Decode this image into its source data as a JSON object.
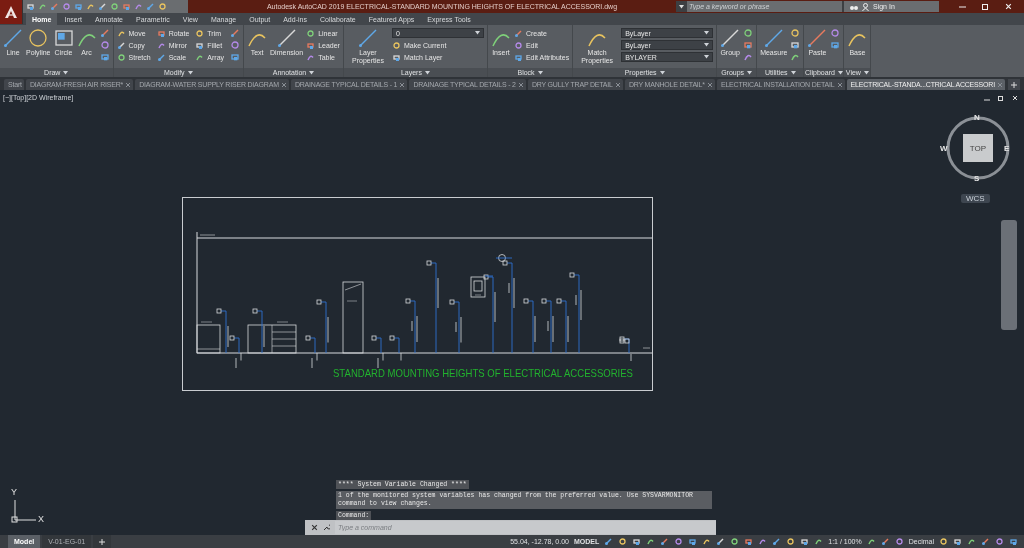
{
  "title_bar": {
    "title": "Autodesk AutoCAD 2019    ELECTRICAL-STANDARD MOUNTING HEIGHTS OF ELECTRICAL ACCESSORI.dwg",
    "search": {
      "placeholder": "Type a keyword or phrase"
    },
    "sign_in": "Sign In"
  },
  "ribbon_tabs": [
    {
      "label": "Home",
      "selected": true
    },
    {
      "label": "Insert",
      "selected": false
    },
    {
      "label": "Annotate",
      "selected": false
    },
    {
      "label": "Parametric",
      "selected": false
    },
    {
      "label": "View",
      "selected": false
    },
    {
      "label": "Manage",
      "selected": false
    },
    {
      "label": "Output",
      "selected": false
    },
    {
      "label": "Add-ins",
      "selected": false
    },
    {
      "label": "Collaborate",
      "selected": false
    },
    {
      "label": "Featured Apps",
      "selected": false
    },
    {
      "label": "Express Tools",
      "selected": false
    }
  ],
  "ribbon_panels": [
    {
      "title": "Draw",
      "tools": [
        {
          "kind": "large",
          "label": "Line"
        },
        {
          "kind": "large",
          "label": "Polyline"
        },
        {
          "kind": "large",
          "label": "Circle"
        },
        {
          "kind": "large",
          "label": "Arc"
        },
        {
          "kind": "icon"
        },
        {
          "kind": "icon"
        },
        {
          "kind": "icon"
        }
      ]
    },
    {
      "title": "Modify",
      "tools": [
        {
          "kind": "small",
          "label": "Move"
        },
        {
          "kind": "small",
          "label": "Copy"
        },
        {
          "kind": "small",
          "label": "Stretch"
        },
        {
          "kind": "small",
          "label": "Rotate"
        },
        {
          "kind": "small",
          "label": "Mirror"
        },
        {
          "kind": "small",
          "label": "Scale"
        },
        {
          "kind": "small",
          "label": "Trim"
        },
        {
          "kind": "small",
          "label": "Fillet"
        },
        {
          "kind": "small",
          "label": "Array"
        },
        {
          "kind": "icon"
        },
        {
          "kind": "icon"
        },
        {
          "kind": "icon"
        }
      ]
    },
    {
      "title": "Annotation",
      "tools": [
        {
          "kind": "large",
          "label": "Text"
        },
        {
          "kind": "large",
          "label": "Dimension"
        },
        {
          "kind": "small",
          "label": "Linear"
        },
        {
          "kind": "small",
          "label": "Leader"
        },
        {
          "kind": "small",
          "label": "Table"
        }
      ]
    },
    {
      "title": "Layers",
      "tools": [
        {
          "kind": "large",
          "label": "Layer Properties"
        },
        {
          "kind": "dropdown",
          "label": "0"
        },
        {
          "kind": "small",
          "label": "Make Current"
        },
        {
          "kind": "small",
          "label": "Match Layer"
        }
      ]
    },
    {
      "title": "Block",
      "tools": [
        {
          "kind": "large",
          "label": "Insert"
        },
        {
          "kind": "small",
          "label": "Create"
        },
        {
          "kind": "small",
          "label": "Edit"
        },
        {
          "kind": "small",
          "label": "Edit Attributes"
        }
      ]
    },
    {
      "title": "Properties",
      "tools": [
        {
          "kind": "large",
          "label": "Match Properties"
        },
        {
          "kind": "dropdown",
          "label": "ByLayer"
        },
        {
          "kind": "dropdown",
          "label": "ByLayer"
        },
        {
          "kind": "dropdown",
          "label": "BYLAYER"
        }
      ]
    },
    {
      "title": "Groups",
      "tools": [
        {
          "kind": "large",
          "label": "Group"
        },
        {
          "kind": "icon"
        },
        {
          "kind": "icon"
        },
        {
          "kind": "icon"
        }
      ]
    },
    {
      "title": "Utilities",
      "tools": [
        {
          "kind": "large",
          "label": "Measure"
        },
        {
          "kind": "icon"
        },
        {
          "kind": "icon"
        },
        {
          "kind": "icon"
        }
      ]
    },
    {
      "title": "Clipboard",
      "tools": [
        {
          "kind": "large",
          "label": "Paste"
        },
        {
          "kind": "icon"
        },
        {
          "kind": "icon"
        }
      ]
    },
    {
      "title": "View",
      "tools": [
        {
          "kind": "large",
          "label": "Base"
        }
      ]
    }
  ],
  "file_tabs": [
    {
      "label": "Start",
      "selected": false,
      "closable": false
    },
    {
      "label": "DIAGRAM-FRESH  AIR RISER*",
      "selected": false,
      "closable": true
    },
    {
      "label": "DIAGRAM-WATER SUPPLY RISER DIAGRAM",
      "selected": false,
      "closable": true
    },
    {
      "label": "DRAINAGE TYPICAL DETAILS - 1",
      "selected": false,
      "closable": true
    },
    {
      "label": "DRAINAGE TYPICAL DETAILS - 2",
      "selected": false,
      "closable": true
    },
    {
      "label": "DRY GULLY TRAP DETAIL",
      "selected": false,
      "closable": true
    },
    {
      "label": "DRY MANHOLE DETAIL*",
      "selected": false,
      "closable": true
    },
    {
      "label": "ELECTRICAL INSTALLATION DETAIL",
      "selected": false,
      "closable": true
    },
    {
      "label": "ELECTRICAL-STANDA...CTRICAL ACCESSORI",
      "selected": true,
      "closable": true
    }
  ],
  "viewport": {
    "label": "[−][Top][2D Wireframe]",
    "drawing_title": "STANDARD MOUNTING HEIGHTS OF ELECTRICAL ACCESSORIES",
    "view_cube": {
      "north": "N",
      "south": "S",
      "east": "E",
      "west": "W",
      "face": "TOP",
      "ucs": "WCS"
    },
    "axes": {
      "x": "X",
      "y": "Y"
    }
  },
  "command_history": {
    "header": "**** System Variable Changed ****",
    "message": "1 of the monitored system variables has changed from the preferred value. Use SYSVARMONITOR command to view changes.",
    "prompt": "Command:"
  },
  "command_line": {
    "placeholder": "Type a command"
  },
  "layout_tabs": [
    {
      "label": "Model",
      "selected": true
    },
    {
      "label": "V-01-EG-01",
      "selected": false
    }
  ],
  "status_bar": {
    "coordinates": "55.04, -12.78, 0.00",
    "space": "MODEL",
    "scale": "1:1 / 100%",
    "units": "Decimal"
  }
}
